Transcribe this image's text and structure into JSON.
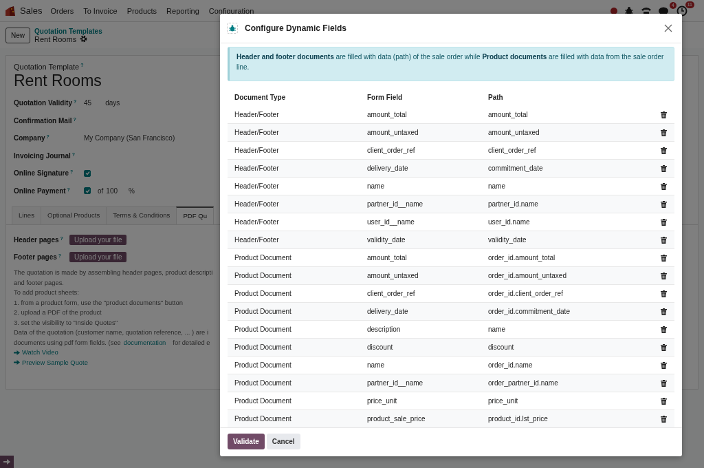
{
  "navbar": {
    "app_name": "Sales",
    "menu": [
      "Orders",
      "To Invoice",
      "Products",
      "Reporting",
      "Configuration"
    ],
    "chat_badge": "4",
    "activity_badge": "11"
  },
  "control_panel": {
    "new_button": "New",
    "breadcrumb": "Quotation Templates",
    "record": "Rent Rooms"
  },
  "form": {
    "title_label": "Quotation Template",
    "title_help": "?",
    "title": "Rent Rooms",
    "fields": [
      {
        "kind": "value",
        "label": "Quotation Validity",
        "help": "?",
        "value": "45",
        "suffix": "days"
      },
      {
        "kind": "empty",
        "label": "Confirmation Mail",
        "help": "?"
      },
      {
        "kind": "value",
        "label": "Company",
        "help": "?",
        "value": "My Company (San Francisco)"
      },
      {
        "kind": "empty",
        "label": "Invoicing Journal",
        "help": "?"
      },
      {
        "kind": "checkbox",
        "label": "Online Signature",
        "help": "?",
        "checked": true
      },
      {
        "kind": "checkbox",
        "label": "Online Payment",
        "help": "?",
        "checked": true,
        "prefix": "of",
        "value": "100",
        "suffix": "%"
      }
    ],
    "tabs": [
      {
        "label": "Lines",
        "selected": false
      },
      {
        "label": "Optional Products",
        "selected": false
      },
      {
        "label": "Terms & Conditions",
        "selected": false
      },
      {
        "label": "PDF Qu",
        "selected": true
      }
    ],
    "uploads": [
      {
        "label": "Header pages",
        "help": "?",
        "button": "Upload your file"
      },
      {
        "label": "Footer pages",
        "help": "?",
        "button": "Upload your file"
      }
    ],
    "help_lines": [
      "The quotation is made by assembling header pages, product descripti",
      "and footer pages.",
      "To add product sheets:",
      "1. from a product form, use the \"product documents\" button",
      "2. upload a PDF of the product",
      "3. set the visibility to \"Inside Quotes\"",
      "Data of the quotation (customer name, quotation reference, ... ) are i"
    ],
    "doc_line": {
      "before": "documents using pdf form fields. (see",
      "link": "documentation",
      "after": "for detailed e"
    },
    "links": [
      "Watch Video",
      "Preview Sample Quote"
    ]
  },
  "dialog": {
    "title": "Configure Dynamic Fields",
    "alert": "**Header and footer documents** are filled with data (path) of the sale order while **Product documents** are filled with data from the sale order line.",
    "columns": [
      "Document Type",
      "Form Field",
      "Path"
    ],
    "rows": [
      [
        "Header/Footer",
        "amount_total",
        "amount_total"
      ],
      [
        "Header/Footer",
        "amount_untaxed",
        "amount_untaxed"
      ],
      [
        "Header/Footer",
        "client_order_ref",
        "client_order_ref"
      ],
      [
        "Header/Footer",
        "delivery_date",
        "commitment_date"
      ],
      [
        "Header/Footer",
        "name",
        "name"
      ],
      [
        "Header/Footer",
        "partner_id__name",
        "partner_id.name"
      ],
      [
        "Header/Footer",
        "user_id__name",
        "user_id.name"
      ],
      [
        "Header/Footer",
        "validity_date",
        "validity_date"
      ],
      [
        "Product Document",
        "amount_total",
        "order_id.amount_total"
      ],
      [
        "Product Document",
        "amount_untaxed",
        "order_id.amount_untaxed"
      ],
      [
        "Product Document",
        "client_order_ref",
        "order_id.client_order_ref"
      ],
      [
        "Product Document",
        "delivery_date",
        "order_id.commitment_date"
      ],
      [
        "Product Document",
        "description",
        "name"
      ],
      [
        "Product Document",
        "discount",
        "discount"
      ],
      [
        "Product Document",
        "name",
        "order_id.name"
      ],
      [
        "Product Document",
        "partner_id__name",
        "order_partner_id.name"
      ],
      [
        "Product Document",
        "price_unit",
        "price_unit"
      ],
      [
        "Product Document",
        "product_sale_price",
        "product_id.lst_price"
      ]
    ],
    "buttons": [
      "Validate",
      "Cancel"
    ]
  }
}
